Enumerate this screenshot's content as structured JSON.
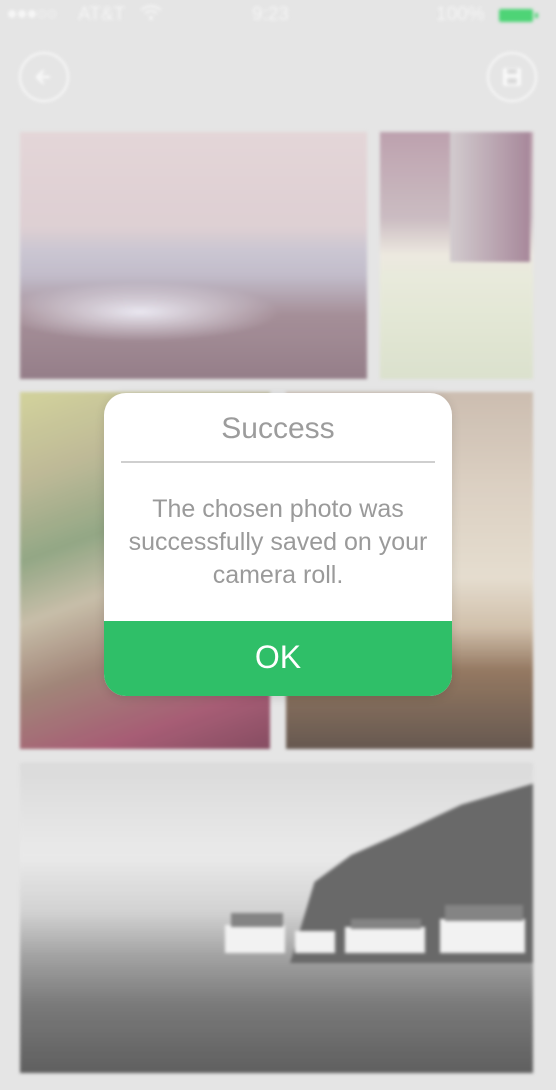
{
  "status_bar": {
    "carrier": "AT&T",
    "time": "9:23",
    "battery": "100%"
  },
  "nav": {
    "back_icon": "arrow-left-icon",
    "save_icon": "save-icon"
  },
  "alert": {
    "title": "Success",
    "message": "The chosen photo was successfully saved on your camera roll.",
    "ok_label": "OK"
  },
  "colors": {
    "accent": "#2fbf68",
    "battery": "#3fd16b",
    "alert_text": "#9c9c9c"
  }
}
